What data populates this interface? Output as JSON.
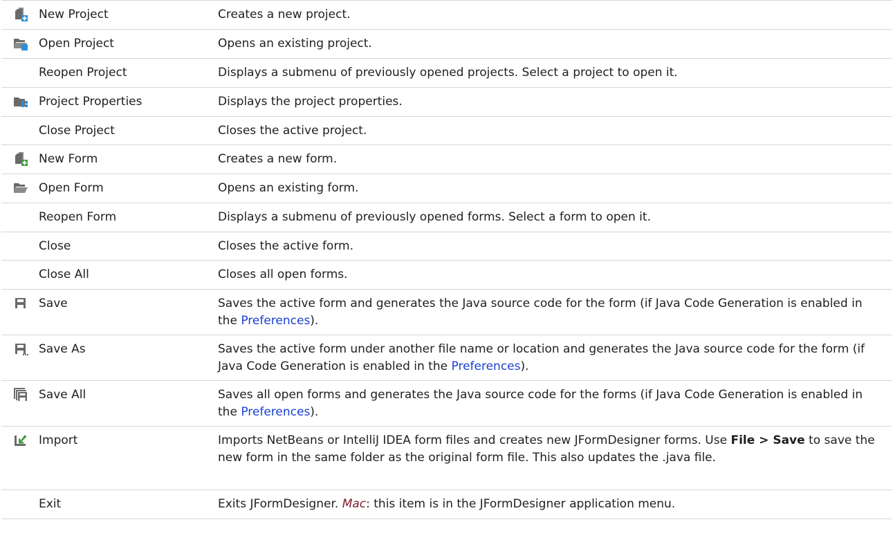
{
  "menu_items": [
    {
      "name": "New Project",
      "icon": "new-project-icon",
      "desc": "Creates a new project."
    },
    {
      "name": "Open Project",
      "icon": "open-project-icon",
      "desc": "Opens an existing project."
    },
    {
      "name": "Reopen Project",
      "icon": "",
      "desc": "Displays a submenu of previously opened projects. Select a project to open it."
    },
    {
      "name": "Project Properties",
      "icon": "project-properties-icon",
      "desc": "Displays the project properties."
    },
    {
      "name": "Close Project",
      "icon": "",
      "desc": "Closes the active project."
    },
    {
      "name": "New Form",
      "icon": "new-form-icon",
      "desc": "Creates a new form."
    },
    {
      "name": "Open Form",
      "icon": "open-form-icon",
      "desc": "Opens an existing form."
    },
    {
      "name": "Reopen Form",
      "icon": "",
      "desc": "Displays a submenu of previously opened forms. Select a form to open it."
    },
    {
      "name": "Close",
      "icon": "",
      "desc": "Closes the active form."
    },
    {
      "name": "Close All",
      "icon": "",
      "desc": "Closes all open forms."
    },
    {
      "name": "Save",
      "icon": "save-icon",
      "desc_before": "Saves the active form and generates the Java source code for the form (if Java Code Generation is enabled in the ",
      "link": "Preferences",
      "desc_after": ")."
    },
    {
      "name": "Save As",
      "icon": "save-as-icon",
      "desc_before": "Saves the active form under another file name or location and generates the Java source code for the form (if Java Code Generation is enabled in the ",
      "link": "Preferences",
      "desc_after": ")."
    },
    {
      "name": "Save All",
      "icon": "save-all-icon",
      "desc_before": "Saves all open forms and generates the Java source code for the forms (if Java Code Generation is enabled in the ",
      "link": "Preferences",
      "desc_after": ")."
    },
    {
      "name": "Import",
      "icon": "import-icon",
      "desc_before": "Imports NetBeans or IntelliJ IDEA form files and creates new JFormDesigner forms. Use ",
      "bold": "File > Save",
      "desc_after": " to save the new form in the same folder as the original form file. This also updates the .java file."
    },
    {
      "name": "Exit",
      "icon": "",
      "desc_before": "Exits JFormDesigner. ",
      "em": "Mac",
      "desc_after": ": this item is in the JFormDesigner application menu."
    }
  ],
  "colors": {
    "link": "#1a3fd1",
    "mac": "#7b1a2b",
    "icon": "#6a6a6a",
    "accent": "#2d8fd5",
    "green": "#3e9a3e"
  }
}
